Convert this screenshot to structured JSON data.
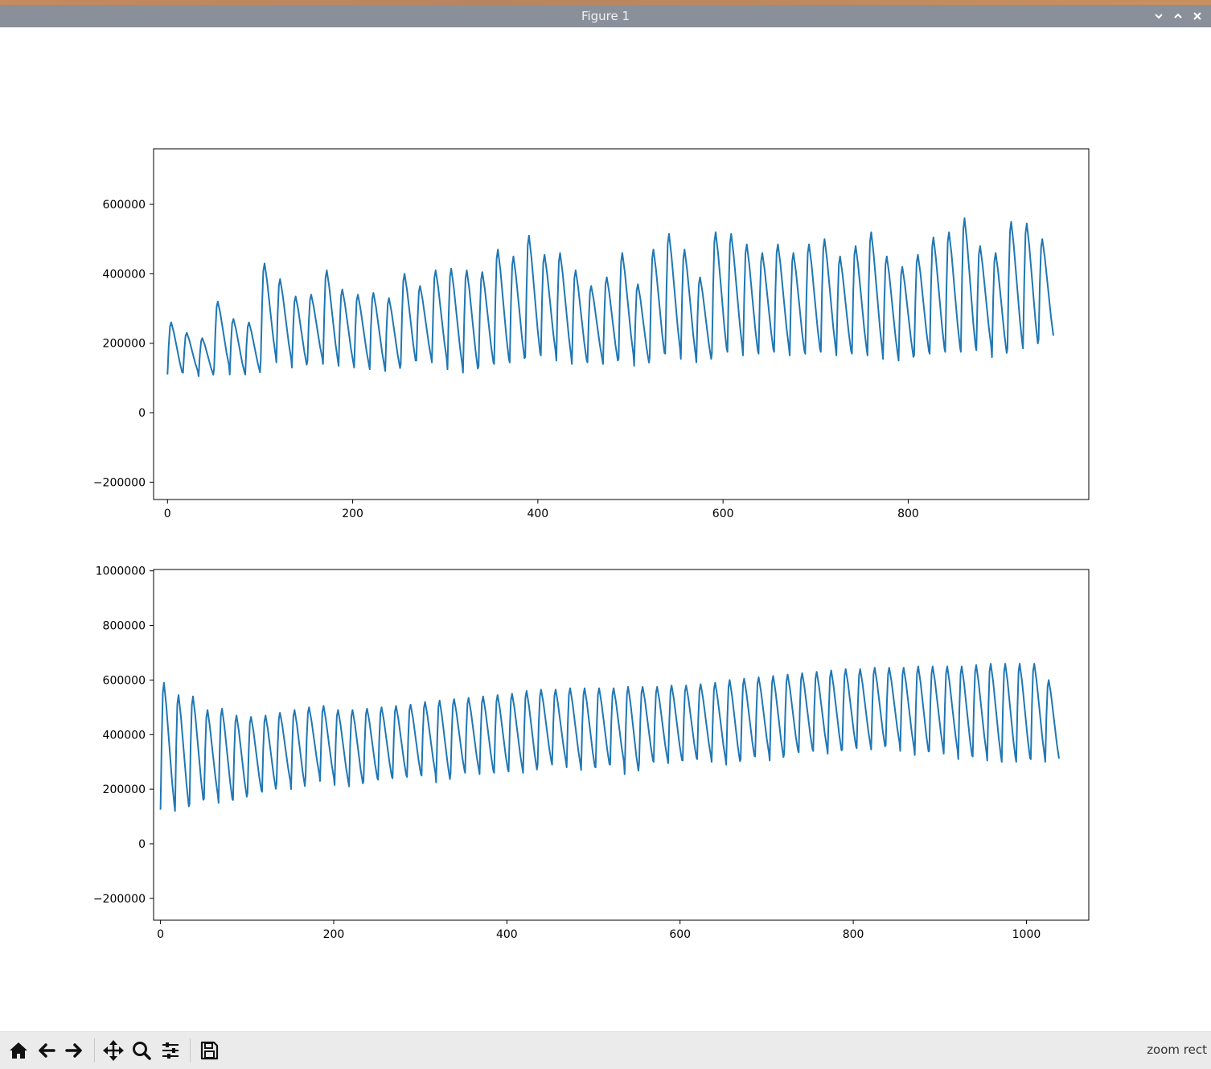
{
  "window": {
    "title": "Figure 1"
  },
  "titlebar_buttons": [
    {
      "name": "minimize-button",
      "icon": "chevron-down-icon"
    },
    {
      "name": "maximize-button",
      "icon": "chevron-up-icon"
    },
    {
      "name": "close-button",
      "icon": "close-icon"
    }
  ],
  "toolbar": {
    "buttons": [
      {
        "name": "home-button",
        "icon": "home-icon"
      },
      {
        "name": "back-button",
        "icon": "arrow-left-icon"
      },
      {
        "name": "forward-button",
        "icon": "arrow-right-icon"
      },
      {
        "name": "pan-button",
        "icon": "move-icon"
      },
      {
        "name": "zoom-button",
        "icon": "magnifier-icon"
      },
      {
        "name": "configure-subplots-button",
        "icon": "sliders-icon"
      },
      {
        "name": "save-button",
        "icon": "floppy-disk-icon"
      }
    ],
    "status": "zoom rect"
  },
  "colors": {
    "line": "#1f77b4",
    "titlebar": "#8a9099",
    "toolbar": "#ebebeb"
  },
  "chart_data": [
    {
      "type": "line",
      "xlim": [
        -15,
        995
      ],
      "ylim": [
        -250000,
        760000
      ],
      "xticks": [
        0,
        200,
        400,
        600,
        800
      ],
      "xtick_labels": [
        "0",
        "200",
        "400",
        "600",
        "800"
      ],
      "yticks": [
        -200000,
        0,
        200000,
        400000,
        600000
      ],
      "ytick_labels": [
        "−200000",
        "0",
        "200000",
        "400000",
        "600000"
      ],
      "title": "",
      "xlabel": "",
      "ylabel": "",
      "grid": false,
      "series": [
        {
          "cycle_x_start": 0,
          "cycle_length": 16.8,
          "cycle_peaks": [
            260000,
            230000,
            215000,
            320000,
            270000,
            260000,
            430000,
            385000,
            335000,
            340000,
            410000,
            355000,
            340000,
            345000,
            330000,
            400000,
            365000,
            410000,
            415000,
            410000,
            405000,
            470000,
            450000,
            510000,
            455000,
            460000,
            410000,
            365000,
            390000,
            460000,
            370000,
            470000,
            515000,
            470000,
            390000,
            520000,
            515000,
            485000,
            460000,
            485000,
            460000,
            485000,
            500000,
            450000,
            480000,
            520000,
            450000,
            420000,
            455000,
            505000,
            520000,
            560000,
            480000,
            460000,
            550000,
            545000,
            500000
          ],
          "cycle_troughs": [
            110000,
            115000,
            105000,
            130000,
            110000,
            110000,
            155000,
            145000,
            130000,
            150000,
            140000,
            135000,
            130000,
            125000,
            120000,
            140000,
            150000,
            145000,
            125000,
            115000,
            135000,
            140000,
            145000,
            160000,
            165000,
            150000,
            140000,
            145000,
            140000,
            155000,
            135000,
            160000,
            170000,
            155000,
            145000,
            170000,
            175000,
            165000,
            170000,
            175000,
            165000,
            170000,
            175000,
            165000,
            170000,
            165000,
            155000,
            150000,
            165000,
            170000,
            175000,
            175000,
            180000,
            160000,
            185000,
            185000,
            210000
          ]
        }
      ]
    },
    {
      "type": "line",
      "xlim": [
        -8,
        1072
      ],
      "ylim": [
        -280000,
        1005000
      ],
      "xticks": [
        0,
        200,
        400,
        600,
        800,
        1000
      ],
      "xtick_labels": [
        "0",
        "200",
        "400",
        "600",
        "800",
        "1000"
      ],
      "yticks": [
        -200000,
        0,
        200000,
        400000,
        600000,
        800000,
        1000000
      ],
      "ytick_labels": [
        "−200000",
        "0",
        "200000",
        "400000",
        "600000",
        "800000",
        "1000000"
      ],
      "title": "",
      "xlabel": "",
      "ylabel": "",
      "grid": false,
      "series": [
        {
          "cycle_x_start": 0,
          "cycle_length": 16.75,
          "cycle_peaks": [
            590000,
            545000,
            540000,
            490000,
            495000,
            470000,
            465000,
            470000,
            480000,
            490000,
            500000,
            505000,
            490000,
            490000,
            495000,
            500000,
            505000,
            510000,
            520000,
            525000,
            530000,
            535000,
            540000,
            545000,
            550000,
            560000,
            565000,
            565000,
            570000,
            570000,
            570000,
            570000,
            575000,
            575000,
            575000,
            580000,
            580000,
            585000,
            590000,
            600000,
            605000,
            610000,
            615000,
            620000,
            625000,
            630000,
            635000,
            640000,
            640000,
            645000,
            645000,
            645000,
            650000,
            650000,
            650000,
            650000,
            655000,
            660000,
            660000,
            660000,
            660000,
            600000
          ],
          "cycle_troughs": [
            125000,
            120000,
            145000,
            165000,
            150000,
            160000,
            185000,
            190000,
            220000,
            200000,
            245000,
            230000,
            215000,
            210000,
            230000,
            235000,
            240000,
            245000,
            250000,
            225000,
            260000,
            260000,
            255000,
            260000,
            265000,
            260000,
            290000,
            290000,
            280000,
            270000,
            280000,
            290000,
            255000,
            295000,
            300000,
            295000,
            305000,
            310000,
            300000,
            290000,
            310000,
            320000,
            305000,
            330000,
            335000,
            340000,
            330000,
            345000,
            350000,
            345000,
            360000,
            340000,
            325000,
            340000,
            330000,
            310000,
            320000,
            305000,
            300000,
            300000,
            310000,
            300000
          ]
        }
      ]
    }
  ]
}
